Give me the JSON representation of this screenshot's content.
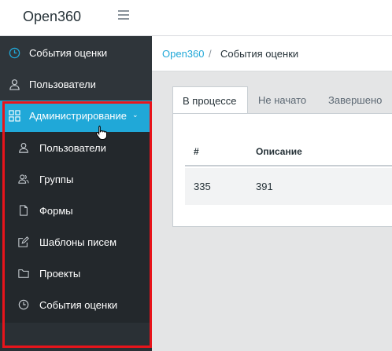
{
  "header": {
    "brand": "Open360",
    "menu_icon": "hamburger-icon"
  },
  "sidebar": {
    "items": [
      {
        "label": "События оценки",
        "icon": "clock-icon"
      },
      {
        "label": "Пользователи",
        "icon": "user-icon"
      },
      {
        "label": "Администрирование",
        "icon": "grid-icon",
        "active": true,
        "expanded": true
      }
    ],
    "admin_submenu": [
      {
        "label": "Пользователи",
        "icon": "user-icon"
      },
      {
        "label": "Группы",
        "icon": "users-icon"
      },
      {
        "label": "Формы",
        "icon": "file-icon"
      },
      {
        "label": "Шаблоны писем",
        "icon": "edit-icon"
      },
      {
        "label": "Проекты",
        "icon": "folder-icon"
      },
      {
        "label": "События оценки",
        "icon": "clock-icon"
      }
    ]
  },
  "breadcrumb": {
    "root": "Open360",
    "separator": "/",
    "current": "События оценки"
  },
  "tabs": [
    {
      "label": "В процессе",
      "active": true
    },
    {
      "label": "Не начато"
    },
    {
      "label": "Завершено"
    }
  ],
  "table": {
    "columns": [
      "#",
      "Описание"
    ],
    "rows": [
      [
        "335",
        "391"
      ]
    ]
  },
  "colors": {
    "accent": "#20a8d8",
    "sidebar": "#2f353a",
    "highlight": "#e8141b"
  }
}
